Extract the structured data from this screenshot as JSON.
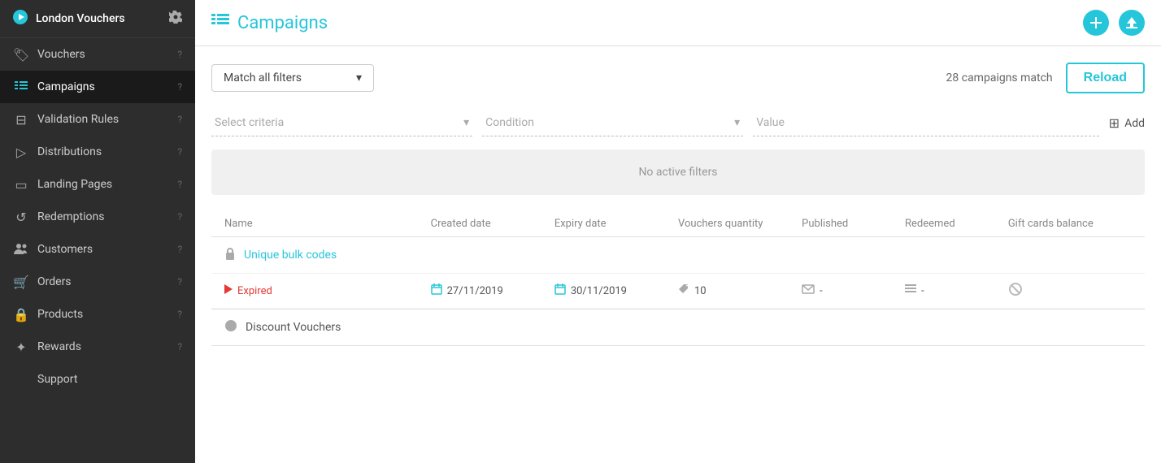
{
  "sidebar": {
    "workspace": "London Vouchers",
    "items": [
      {
        "id": "vouchers",
        "label": "Vouchers",
        "icon": "tag-icon"
      },
      {
        "id": "campaigns",
        "label": "Campaigns",
        "icon": "list-icon",
        "active": true
      },
      {
        "id": "validation-rules",
        "label": "Validation Rules",
        "icon": "funnel-icon"
      },
      {
        "id": "distributions",
        "label": "Distributions",
        "icon": "triangle-icon"
      },
      {
        "id": "landing-pages",
        "label": "Landing Pages",
        "icon": "card-icon"
      },
      {
        "id": "redemptions",
        "label": "Redemptions",
        "icon": "refresh-icon"
      },
      {
        "id": "customers",
        "label": "Customers",
        "icon": "people-icon"
      },
      {
        "id": "orders",
        "label": "Orders",
        "icon": "cart-icon"
      },
      {
        "id": "products",
        "label": "Products",
        "icon": "box-icon"
      },
      {
        "id": "rewards",
        "label": "Rewards",
        "icon": "star-icon"
      },
      {
        "id": "support",
        "label": "Support",
        "icon": ""
      }
    ]
  },
  "header": {
    "title": "Campaigns",
    "add_label": "+",
    "export_label": "↑"
  },
  "filter": {
    "match_label": "Match all filters",
    "chevron": "▾",
    "campaigns_match": "28 campaigns match",
    "reload_label": "Reload",
    "criteria_placeholder": "Select criteria",
    "condition_placeholder": "Condition",
    "value_placeholder": "Value",
    "add_label": "Add",
    "no_filters_label": "No active filters"
  },
  "table": {
    "columns": [
      "Name",
      "Created date",
      "Expiry date",
      "Vouchers quantity",
      "Published",
      "Redeemed",
      "Gift cards balance"
    ],
    "campaigns": [
      {
        "name": "Unique bulk codes",
        "icon": "lock",
        "status": "Expired",
        "created_date": "27/11/2019",
        "expiry_date": "30/11/2019",
        "vouchers_qty": "10",
        "published": "-",
        "redeemed": "-",
        "gift_balance": "-"
      },
      {
        "name": "Discount Vouchers",
        "icon": "dollar"
      }
    ]
  }
}
